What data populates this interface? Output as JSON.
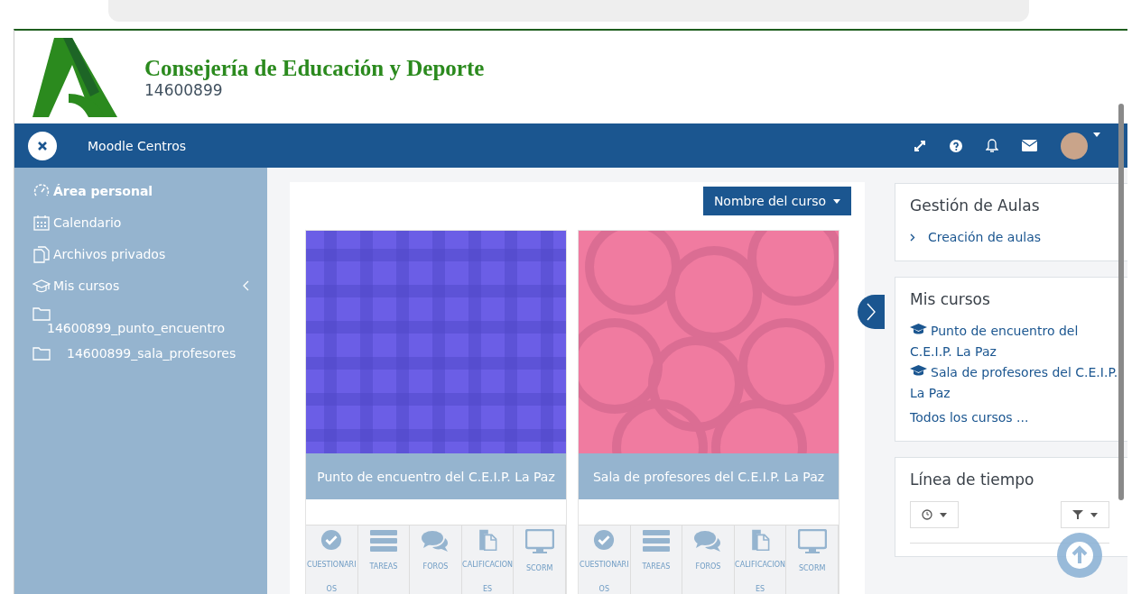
{
  "header": {
    "title": "Consejería de Educación y Deporte",
    "code": "14600899"
  },
  "navbar": {
    "site_name": "Moodle Centros"
  },
  "sidebar": {
    "items": [
      {
        "label": "Área personal",
        "selected": true
      },
      {
        "label": "Calendario",
        "selected": false
      },
      {
        "label": "Archivos privados",
        "selected": false
      },
      {
        "label": "Mis cursos",
        "selected": false,
        "expanded": true,
        "children": [
          {
            "label": "14600899_punto_encuentro"
          },
          {
            "label": "14600899_sala_profesores"
          }
        ]
      }
    ]
  },
  "main": {
    "sort_button": "Nombre del curso",
    "courses": [
      {
        "title": "Punto de encuentro del C.E.I.P. La Paz",
        "kind": "plaid",
        "activities": [
          "CUESTIONARIOS",
          "TAREAS",
          "FOROS",
          "CALIFICACIONES",
          "SCORM"
        ]
      },
      {
        "title": "Sala de profesores del C.E.I.P. La Paz",
        "kind": "circles",
        "activities": [
          "CUESTIONARIOS",
          "TAREAS",
          "FOROS",
          "CALIFICACIONES",
          "SCORM"
        ]
      }
    ]
  },
  "blocks": [
    {
      "title": "Gestión de Aulas",
      "kind": "nav",
      "links": [
        "Creación de aulas"
      ]
    },
    {
      "title": "Mis cursos",
      "kind": "courses",
      "links": [
        "Punto de encuentro del C.E.I.P. La Paz",
        "Sala de profesores del C.E.I.P. La Paz"
      ],
      "more": "Todos los cursos ..."
    },
    {
      "title": "Línea de tiempo",
      "kind": "timeline"
    }
  ]
}
